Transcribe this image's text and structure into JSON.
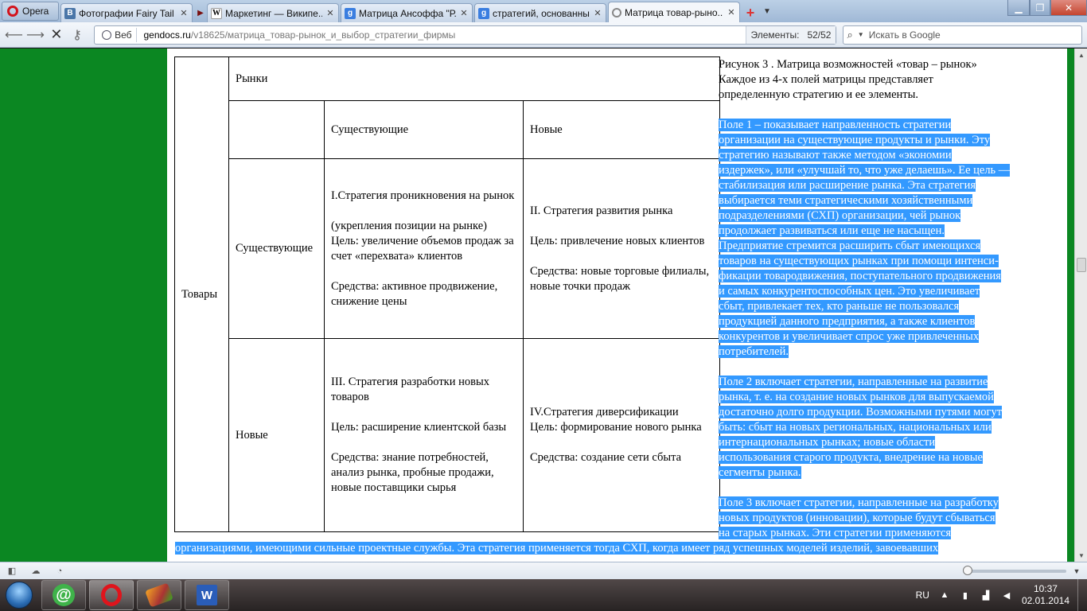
{
  "browser": {
    "menu_label": "Opera",
    "tabs": [
      {
        "title": "Фотографии Fairy Tail ...",
        "favicon": "vk-icon",
        "active": false
      },
      {
        "title": "Маркетинг — Википе...",
        "favicon": "wikipedia-icon",
        "active": false
      },
      {
        "title": "Матрица Ансоффа \"Р...",
        "favicon": "google-icon",
        "active": false
      },
      {
        "title": "стратегий, основанны...",
        "favicon": "google-icon",
        "active": false
      },
      {
        "title": "Матрица товар-рыно...",
        "favicon": "loading-icon",
        "active": true
      }
    ],
    "address": {
      "badge": "Веб",
      "host": "gendocs.ru",
      "path": "/v18625/матрица_товар-рынок_и_выбор_стратегии_фирмы"
    },
    "elements": {
      "label": "Элементы:",
      "value": "52/52"
    },
    "search": {
      "placeholder": "Искать в Google"
    }
  },
  "matrix": {
    "goods": "Товары",
    "markets": "Рынки",
    "col_existing": "Существующие",
    "col_new": "Новые",
    "row_existing": "Существующие",
    "row_new": "Новые",
    "q1": {
      "title": "I.Стратегия проникновения на рынок",
      "goal": "(укрепления позиции на рынке) Цель: увеличение объемов продаж за счет «перехвата» клиентов",
      "means": "Средства: активное продвижение, снижение цены"
    },
    "q2": {
      "title": "II. Стратегия развития рынка",
      "goal": "Цель: привлечение новых клиентов",
      "means": "Средства: новые торговые филиалы, новые точки продаж"
    },
    "q3": {
      "title": "III. Стратегия разработки новых товаров",
      "goal": "Цель: расширение клиентской базы",
      "means": "Средства: знание потребностей, анализ рынка, пробные продажи, новые поставщики сырья"
    },
    "q4": {
      "title": "IV.Стратегия диверсификации",
      "goal": "Цель: формирование нового рынка",
      "means": "Средства: создание сети сбыта"
    }
  },
  "text": {
    "figure_caption": "Рисунок 3 . Матрица возможностей «товар – рынок»",
    "intro_1": "Каждое из 4-х полей матрицы представляет",
    "intro_2": "определенную стратегию и ее элементы.",
    "field1": [
      "Поле 1 – показывает направленность стратегии",
      "организации на существующие продукты и рынки. Эту",
      "стратегию называют также методом «экономии",
      "издержек», или «улучшай то, что уже делаешь». Ее цель —",
      "стабилизация или расширение рынка. Эта стратегия",
      "выбирается теми стратегическими хозяйственными",
      "подразделениями (СХП) организации, чей рынок",
      "продолжает развиваться или еще не насыщен.",
      "Предприятие стремится расширить сбыт имеющихся",
      "товаров на существующих рынках при помощи интенси-",
      "фикации товародвижения, поступательного продвижения",
      "и самых конкурентоспособных цен. Это увеличивает",
      "сбыт, привлекает тех, кто раньше не пользовался",
      "продукцией данного предприятия, а также клиентов",
      "конкурентов и увеличивает спрос уже привлеченных",
      "потребителей."
    ],
    "field2": [
      "Поле 2 включает стратегии, направленные на развитие",
      "рынка, т. е. на создание новых рынков для выпускаемой",
      "достаточно долго продукции. Возможными путями могут",
      "быть: сбыт на новых региональных, национальных или",
      "интернациональных рынках; новые области",
      "использования старого продукта, внедрение на новые",
      "сегменты рынка."
    ],
    "field3": [
      "Поле 3 включает стратегии, направленные на разработку",
      "новых продуктов (инновации), которые будут сбываться",
      "на старых рынках. Эти стратегии применяются"
    ],
    "bottom_line": "организациями, имеющими сильные проектные службы. Эта стратегия применяется тогда СХП, когда имеет ряд успешных моделей изделий, завоевавших"
  },
  "taskbar": {
    "language": "RU",
    "time": "10:37",
    "date": "02.01.2014",
    "apps": [
      "mail-agent-icon",
      "opera-icon",
      "game-icon",
      "word-icon"
    ]
  },
  "colors": {
    "selection": "#3399ff",
    "page_background": "#0b8722"
  }
}
